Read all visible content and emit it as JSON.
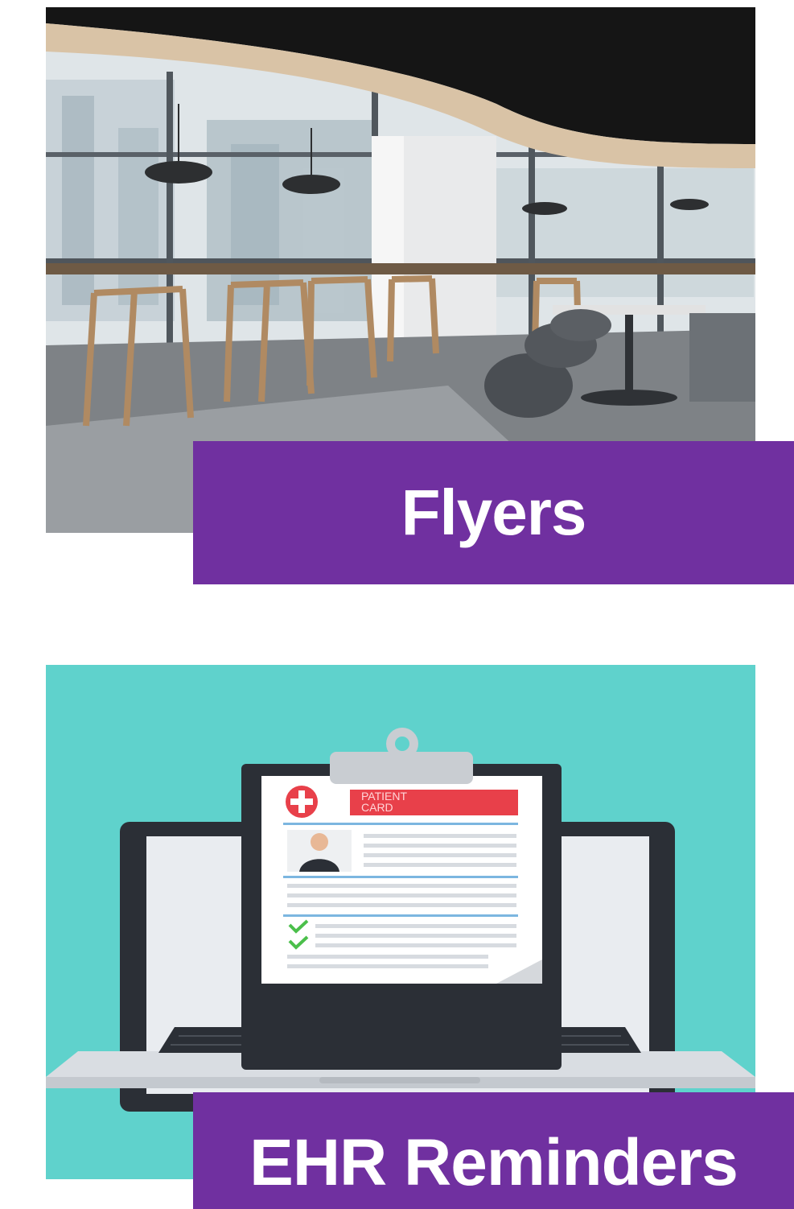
{
  "cards": [
    {
      "label": "Flyers",
      "image": "office-cafe-photo"
    },
    {
      "label": "EHR Reminders",
      "image": "laptop-patient-card-illustration",
      "illustration_text": {
        "card_title": "PATIENT CARD"
      }
    }
  ],
  "colors": {
    "label_background": "#7030a0",
    "label_text": "#ffffff",
    "illustration_background": "#5fd2cc",
    "patient_card_header": "#e8404a",
    "patient_card_cross": "#e8404a",
    "checkmark": "#4bbf4b"
  }
}
